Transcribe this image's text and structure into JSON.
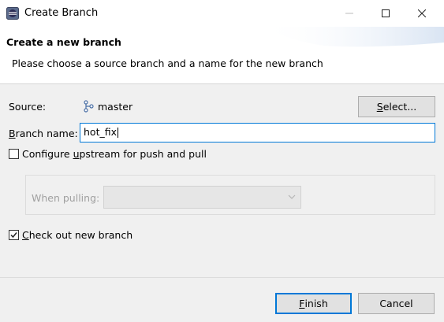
{
  "window": {
    "title": "Create Branch",
    "controls": [
      "minimize",
      "maximize",
      "close"
    ]
  },
  "banner": {
    "title": "Create a new branch",
    "subtitle": "Please choose a source branch and a name for the new branch"
  },
  "source": {
    "label": "Source:",
    "value": "master",
    "icon": "branch-icon",
    "select_button": {
      "mnemonic": "S",
      "rest": "elect..."
    }
  },
  "branch_name": {
    "label_mnemonic": "B",
    "label_rest": "ranch name:",
    "value": "hot_fix"
  },
  "configure_upstream": {
    "checked": false,
    "label_before": "Configure ",
    "label_mnemonic": "u",
    "label_after": "pstream for push and pull"
  },
  "when_pulling": {
    "label": "When pulling:",
    "enabled": false,
    "value": ""
  },
  "checkout": {
    "checked": true,
    "label_mnemonic": "C",
    "label_rest": "heck out new branch"
  },
  "buttons": {
    "finish": {
      "mnemonic": "F",
      "rest": "inish"
    },
    "cancel": "Cancel"
  },
  "colors": {
    "accent": "#0078d7",
    "dialog_bg": "#f0f0f0",
    "disabled_text": "#a0a0a0"
  }
}
